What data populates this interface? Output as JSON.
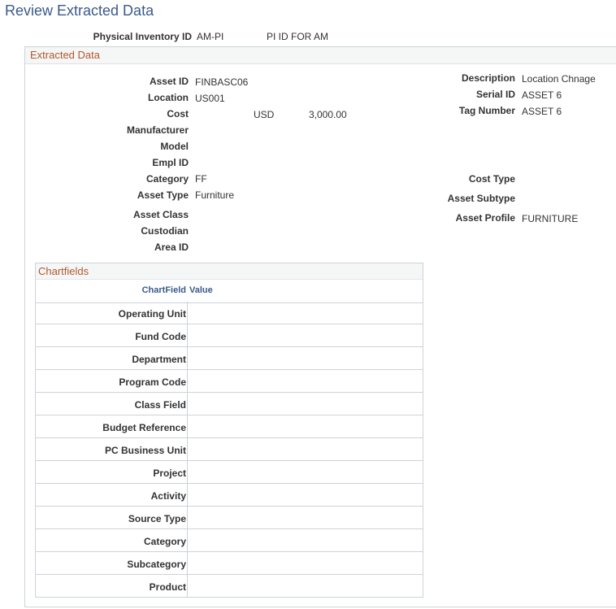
{
  "page": {
    "title": "Review Extracted Data"
  },
  "physical_inventory": {
    "label": "Physical Inventory ID",
    "id": "AM-PI",
    "description": "PI ID FOR AM"
  },
  "extracted": {
    "title": "Extracted Data",
    "asset_id": {
      "label": "Asset ID",
      "value": "FINBASC06"
    },
    "location": {
      "label": "Location",
      "value": "US001"
    },
    "cost": {
      "label": "Cost",
      "currency": "USD",
      "amount": "3,000.00"
    },
    "manufacturer": {
      "label": "Manufacturer",
      "value": ""
    },
    "model": {
      "label": "Model",
      "value": ""
    },
    "empl_id": {
      "label": "Empl ID",
      "value": ""
    },
    "category": {
      "label": "Category",
      "value": "FF"
    },
    "asset_type": {
      "label": "Asset Type",
      "value": "Furniture"
    },
    "asset_class": {
      "label": "Asset Class",
      "value": ""
    },
    "custodian": {
      "label": "Custodian",
      "value": ""
    },
    "area_id": {
      "label": "Area ID",
      "value": ""
    },
    "description": {
      "label": "Description",
      "value": "Location Chnage"
    },
    "serial_id": {
      "label": "Serial ID",
      "value": "ASSET 6"
    },
    "tag_number": {
      "label": "Tag Number",
      "value": "ASSET 6"
    },
    "cost_type": {
      "label": "Cost Type",
      "value": ""
    },
    "asset_subtype": {
      "label": "Asset Subtype",
      "value": ""
    },
    "asset_profile": {
      "label": "Asset Profile",
      "value": "FURNITURE"
    }
  },
  "chartfields": {
    "title": "Chartfields",
    "columns": [
      "ChartField",
      "Value"
    ],
    "rows": [
      {
        "label": "Operating Unit",
        "value": ""
      },
      {
        "label": "Fund Code",
        "value": ""
      },
      {
        "label": "Department",
        "value": ""
      },
      {
        "label": "Program Code",
        "value": ""
      },
      {
        "label": "Class Field",
        "value": ""
      },
      {
        "label": "Budget Reference",
        "value": ""
      },
      {
        "label": "PC Business Unit",
        "value": ""
      },
      {
        "label": "Project",
        "value": ""
      },
      {
        "label": "Activity",
        "value": ""
      },
      {
        "label": "Source Type",
        "value": ""
      },
      {
        "label": "Category",
        "value": ""
      },
      {
        "label": "Subcategory",
        "value": ""
      },
      {
        "label": "Product",
        "value": ""
      }
    ]
  },
  "colors": {
    "title": "#3a5a8a",
    "section_title": "#b4552a",
    "border": "#cdd3d8"
  }
}
